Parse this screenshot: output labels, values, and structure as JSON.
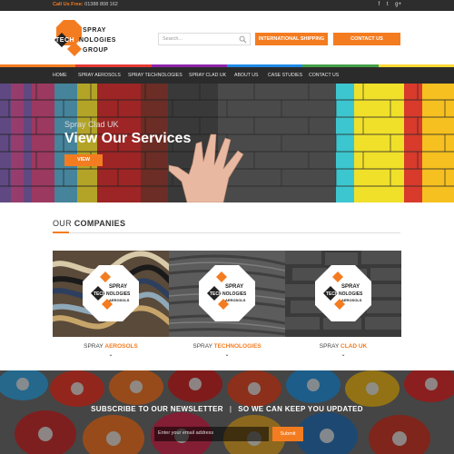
{
  "topbar": {
    "call_label": "Call Us Free:",
    "phone": "01388 808 162",
    "social": [
      {
        "icon": "facebook-icon",
        "glyph": "f"
      },
      {
        "icon": "twitter-icon",
        "glyph": "t"
      },
      {
        "icon": "google-plus-icon",
        "glyph": "g+"
      }
    ]
  },
  "logo": {
    "line1": "SPRAY",
    "line2a": "TECH",
    "line2b": "NOLOGIES",
    "line3": "GROUP"
  },
  "search": {
    "placeholder": "Search..."
  },
  "header_buttons": {
    "shipping": "INTERNATIONAL SHIPPING",
    "contact": "CONTACT US"
  },
  "nav": {
    "items": [
      "HOME",
      "SPRAY AEROSOLS",
      "SPRAY TECHNOLOGIES",
      "SPRAY CLAD UK",
      "ABOUT US",
      "CASE STUDIES",
      "CONTACT US"
    ]
  },
  "hero": {
    "subtitle": "Spray Clad UK",
    "title": "View Our Services",
    "button": "VIEW"
  },
  "companies": {
    "title_prefix": "OUR",
    "title_bold": "COMPANIES",
    "badge": {
      "w1": "SPRAY",
      "w2a": "TECH",
      "w2b": "NOLOGIES",
      "w3": "AEROSOLS"
    },
    "cards": [
      {
        "prefix": "SPRAY",
        "name": "AEROSOLS"
      },
      {
        "prefix": "SPRAY",
        "name": "TECHNOLOGIES"
      },
      {
        "prefix": "SPRAY",
        "name": "CLAD UK"
      }
    ],
    "chevron": "⌄"
  },
  "newsletter": {
    "title_a": "SUBSCRIBE TO OUR NEWSLETTER",
    "separator": "|",
    "title_b": "SO WE CAN KEEP YOU UPDATED",
    "placeholder": "Enter your email address",
    "submit": "Submit"
  },
  "colors": {
    "accent": "#f47c20",
    "nav_bg": "#2b2b2b",
    "topbar_bg": "#2d2d2d"
  }
}
